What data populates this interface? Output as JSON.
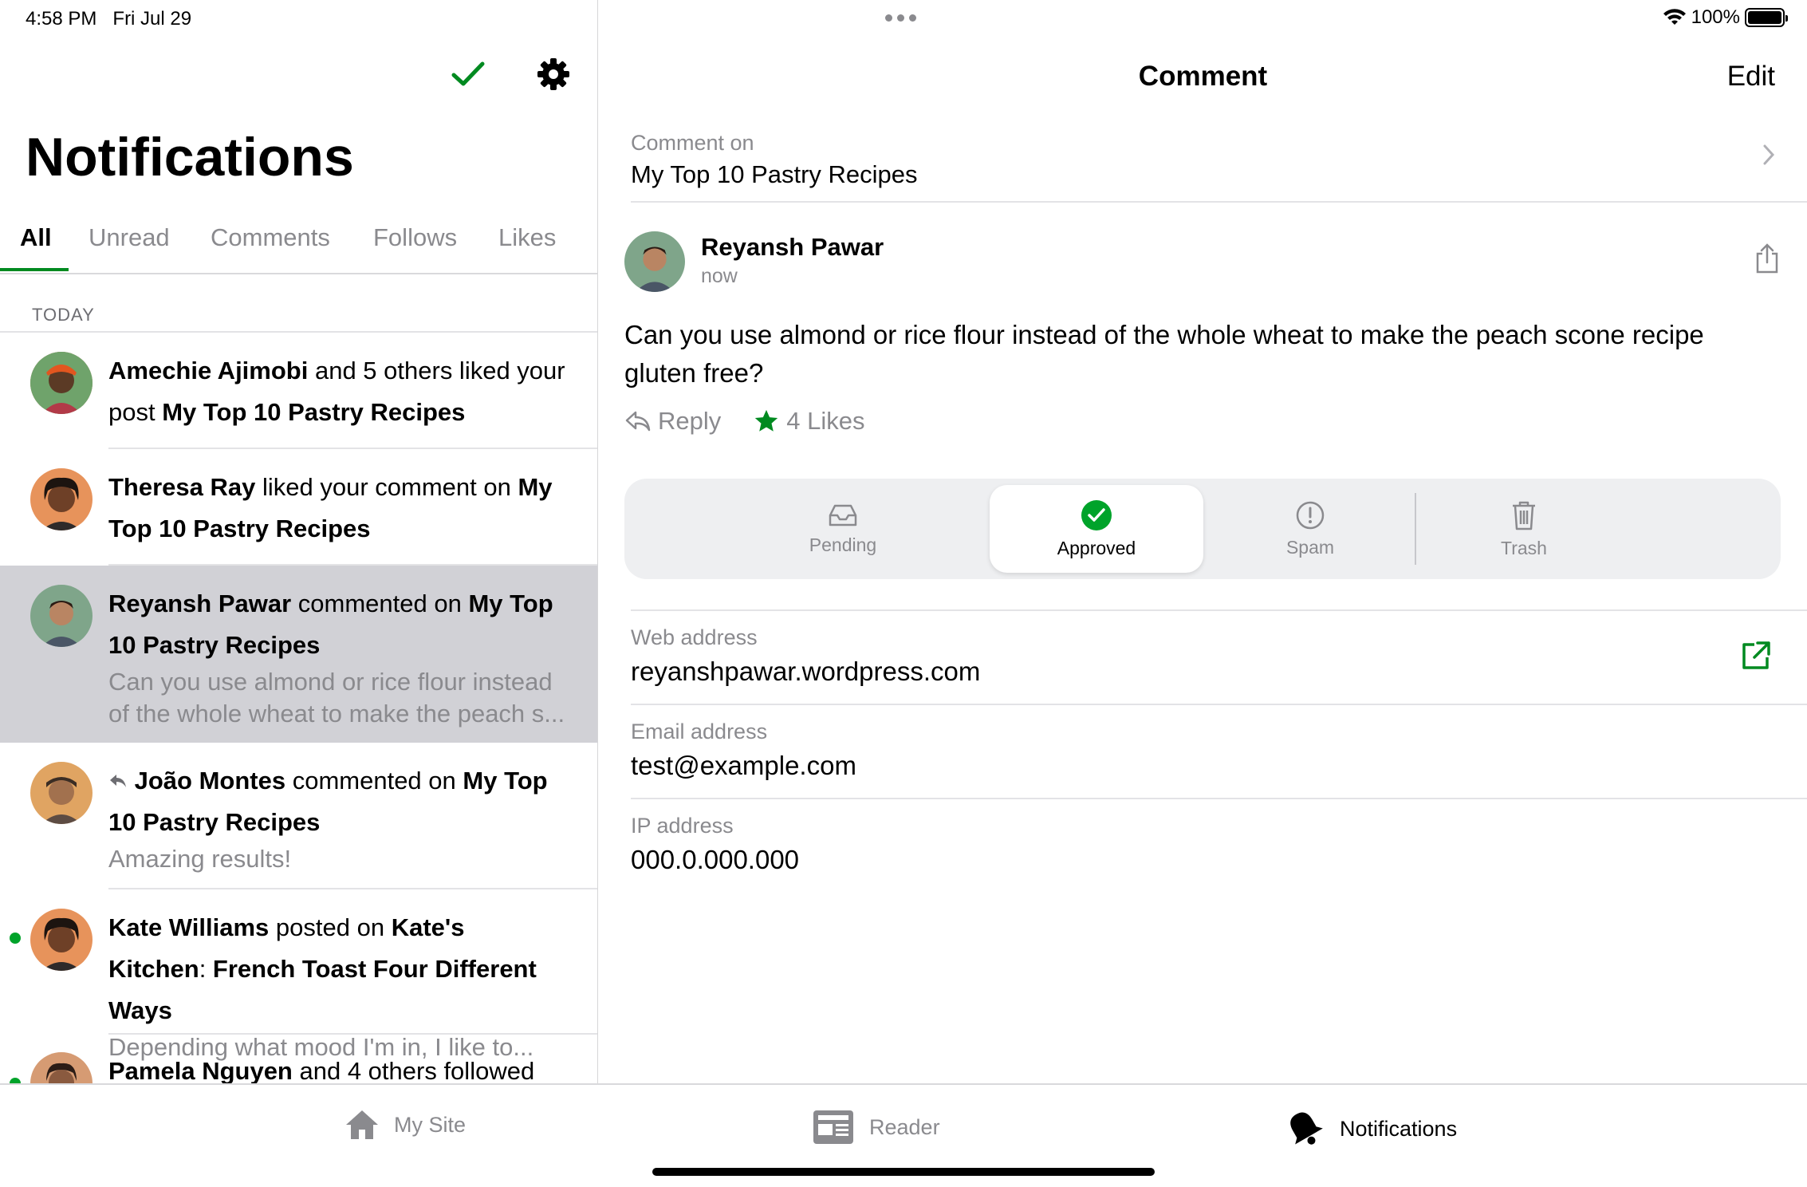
{
  "status": {
    "time": "4:58 PM",
    "date": "Fri Jul 29",
    "battery": "100%"
  },
  "left": {
    "title": "Notifications",
    "tabs": [
      {
        "label": "All",
        "active": true
      },
      {
        "label": "Unread"
      },
      {
        "label": "Comments"
      },
      {
        "label": "Follows"
      },
      {
        "label": "Likes"
      }
    ],
    "section": "TODAY",
    "notes": [
      {
        "name": "Amechie Ajimobi",
        "text": " and 5 others liked your post ",
        "target": "My Top 10 Pastry Recipes",
        "snippet": ""
      },
      {
        "name": "Theresa Ray",
        "text": " liked your comment on ",
        "target": "My Top 10 Pastry Recipes",
        "snippet": ""
      },
      {
        "name": "Reyansh Pawar",
        "text": " commented on ",
        "target": "My Top 10 Pastry Recipes",
        "snippet": "Can you use almond or rice flour instead of the whole wheat to make the peach s..."
      },
      {
        "name": "João Montes",
        "text": " commented on ",
        "target": "My Top 10 Pastry Recipes",
        "snippet": "Amazing results!"
      },
      {
        "name": "Kate Williams",
        "text": " posted on ",
        "target": "Kate's Kitchen",
        "text2": ": ",
        "target2": "French Toast Four Different Ways",
        "snippet": "Depending what mood I'm in, I like to..."
      },
      {
        "name": "Pamela Nguyen",
        "text": " and 4 others followed",
        "snippet": ""
      }
    ]
  },
  "right": {
    "nav_title": "Comment",
    "edit": "Edit",
    "comment_on_label": "Comment on",
    "comment_on_value": "My Top 10 Pastry Recipes",
    "author": "Reyansh Pawar",
    "time": "now",
    "comment": "Can you use almond or rice flour instead of the whole wheat to make the peach scone recipe gluten free?",
    "reply": "Reply",
    "likes": "4 Likes",
    "moderation": {
      "pending": "Pending",
      "approved": "Approved",
      "spam": "Spam",
      "trash": "Trash"
    },
    "web_label": "Web address",
    "web_value": "reyanshpawar.wordpress.com",
    "email_label": "Email address",
    "email_value": "test@example.com",
    "ip_label": "IP address",
    "ip_value": "000.0.000.000"
  },
  "tabbar": {
    "mysite": "My Site",
    "reader": "Reader",
    "notifications": "Notifications"
  },
  "colors": {
    "accent": "#008a20",
    "selected_row": "#d1d1d6",
    "gray_text": "#8a8a8e"
  }
}
